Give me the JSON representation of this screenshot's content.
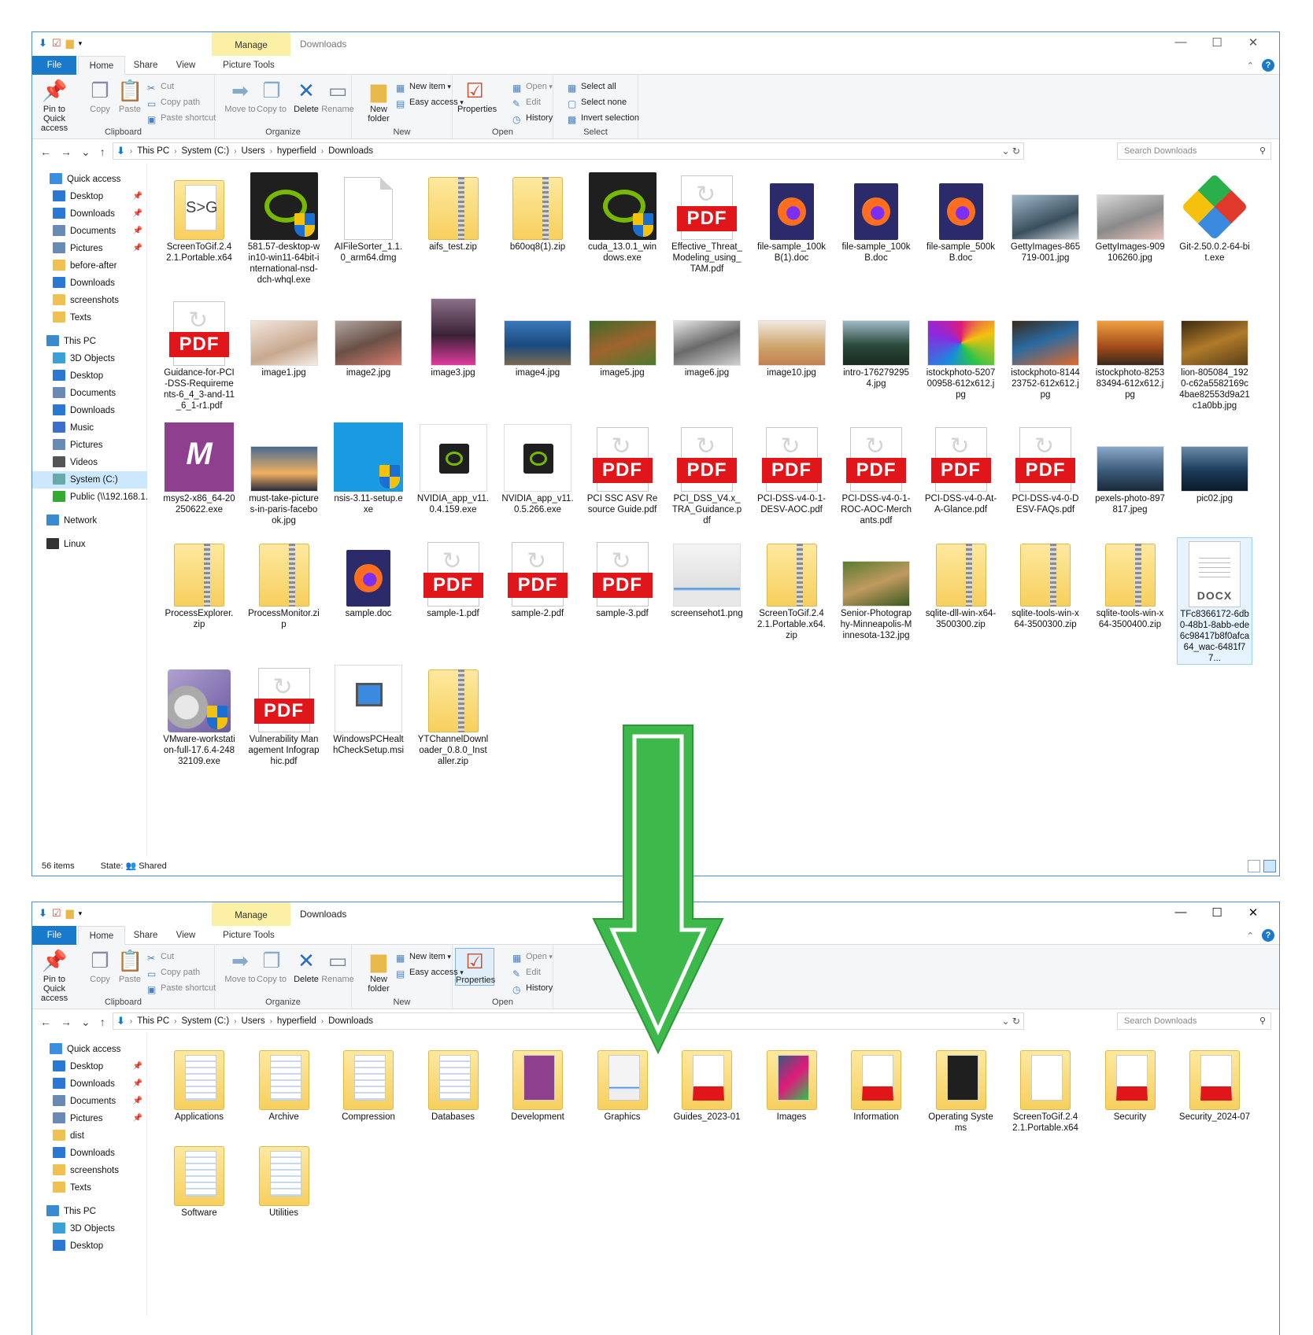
{
  "window_before": {
    "context_tab": "Manage",
    "title": "Downloads",
    "tabs": {
      "file": "File",
      "home": "Home",
      "share": "Share",
      "view": "View",
      "picture_tools": "Picture Tools"
    },
    "ribbon": {
      "pin": "Pin to Quick access",
      "copy": "Copy",
      "paste": "Paste",
      "cut": "Cut",
      "copy_path": "Copy path",
      "paste_shortcut": "Paste shortcut",
      "clipboard": "Clipboard",
      "move_to": "Move to",
      "copy_to": "Copy to",
      "delete": "Delete",
      "rename": "Rename",
      "organize": "Organize",
      "new_folder": "New folder",
      "new_item": "New item",
      "easy_access": "Easy access",
      "new": "New",
      "properties": "Properties",
      "open": "Open",
      "edit": "Edit",
      "history": "History",
      "open_group": "Open",
      "select_all": "Select all",
      "select_none": "Select none",
      "invert_selection": "Invert selection",
      "select": "Select"
    },
    "address": {
      "this_pc": "This PC",
      "drive": "System (C:)",
      "users": "Users",
      "user": "hyperfield",
      "folder": "Downloads"
    },
    "search_placeholder": "Search Downloads",
    "nav": {
      "quick_access": "Quick access",
      "desktop": "Desktop",
      "downloads": "Downloads",
      "documents": "Documents",
      "pictures": "Pictures",
      "before_after": "before-after",
      "downloads2": "Downloads",
      "screenshots": "screenshots",
      "texts": "Texts",
      "this_pc": "This PC",
      "objects3d": "3D Objects",
      "pc_desktop": "Desktop",
      "pc_documents": "Documents",
      "pc_downloads": "Downloads",
      "music": "Music",
      "pc_pictures": "Pictures",
      "videos": "Videos",
      "system_c": "System (C:)",
      "public": "Public (\\\\192.168.1.",
      "network": "Network",
      "linux": "Linux"
    },
    "files": [
      "ScreenToGif.2.42.1.Portable.x64",
      "581.57-desktop-win10-win11-64bit-international-nsd-dch-whql.exe",
      "AIFileSorter_1.1.0_arm64.dmg",
      "aifs_test.zip",
      "b60oq8(1).zip",
      "cuda_13.0.1_windows.exe",
      "Effective_Threat_Modeling_using_TAM.pdf",
      "file-sample_100kB(1).doc",
      "file-sample_100kB.doc",
      "file-sample_500kB.doc",
      "GettyImages-865719-001.jpg",
      "GettyImages-909106260.jpg",
      "Git-2.50.0.2-64-bit.exe",
      "Guidance-for-PCI-DSS-Requirements-6_4_3-and-11_6_1-r1.pdf",
      "image1.jpg",
      "image2.jpg",
      "image3.jpg",
      "image4.jpg",
      "image5.jpg",
      "image6.jpg",
      "image10.jpg",
      "intro-1762792954.jpg",
      "istockphoto-520700958-612x612.jpg",
      "istockphoto-814423752-612x612.jpg",
      "istockphoto-825383494-612x612.jpg",
      "lion-805084_1920-c62a5582169c4bae82553d9a21c1a0bb.jpg",
      "msys2-x86_64-20250622.exe",
      "must-take-pictures-in-paris-facebook.jpg",
      "nsis-3.11-setup.exe",
      "NVIDIA_app_v11.0.4.159.exe",
      "NVIDIA_app_v11.0.5.266.exe",
      "PCI SSC ASV Resource Guide.pdf",
      "PCI_DSS_V4.x_TRA_Guidance.pdf",
      "PCI-DSS-v4-0-1-DESV-AOC.pdf",
      "PCI-DSS-v4-0-1-ROC-AOC-Merchants.pdf",
      "PCI-DSS-v4-0-At-A-Glance.pdf",
      "PCI-DSS-v4-0-DESV-FAQs.pdf",
      "pexels-photo-897817.jpeg",
      "pic02.jpg",
      "ProcessExplorer.zip",
      "ProcessMonitor.zip",
      "sample.doc",
      "sample-1.pdf",
      "sample-2.pdf",
      "sample-3.pdf",
      "screensehot1.png",
      "ScreenToGif.2.42.1.Portable.x64.zip",
      "Senior-Photography-Minneapolis-Minnesota-132.jpg",
      "sqlite-dll-win-x64-3500300.zip",
      "sqlite-tools-win-x64-3500300.zip",
      "sqlite-tools-win-x64-3500400.zip",
      "TFc8366172-6db0-48b1-8abb-ede6c98417b8f0afca64_wac-6481f77...",
      "VMware-workstation-full-17.6.4-24832109.exe",
      "Vulnerability Management Infographic.pdf",
      "WindowsPCHealthCheckSetup.msi",
      "YTChannelDownloader_0.8.0_Installer.zip"
    ],
    "status_items": "56 items",
    "status_state": "State:",
    "status_shared": "Shared"
  },
  "window_after": {
    "context_tab": "Manage",
    "title": "Downloads",
    "ribbon_fragment": "n",
    "nav": {
      "quick_access": "Quick access",
      "desktop": "Desktop",
      "downloads": "Downloads",
      "documents": "Documents",
      "pictures": "Pictures",
      "dist": "dist",
      "downloads2": "Downloads",
      "screenshots": "screenshots",
      "texts": "Texts",
      "this_pc": "This PC",
      "objects3d": "3D Objects",
      "pc_desktop": "Desktop"
    },
    "folders": [
      "Applications",
      "Archive",
      "Compression",
      "Databases",
      "Development",
      "Graphics",
      "Guides_2023-01",
      "Images",
      "Information",
      "Operating Systems",
      "ScreenToGif.2.42.1.Portable.x64",
      "Security",
      "Security_2024-07",
      "Software",
      "Utilities"
    ]
  },
  "colors": {
    "accent": "#1979ca",
    "manage_tab": "#fbf0a6",
    "arrow": "#3db84a",
    "pdf_badge": "#e1161b",
    "selection": "#cce8ff"
  }
}
